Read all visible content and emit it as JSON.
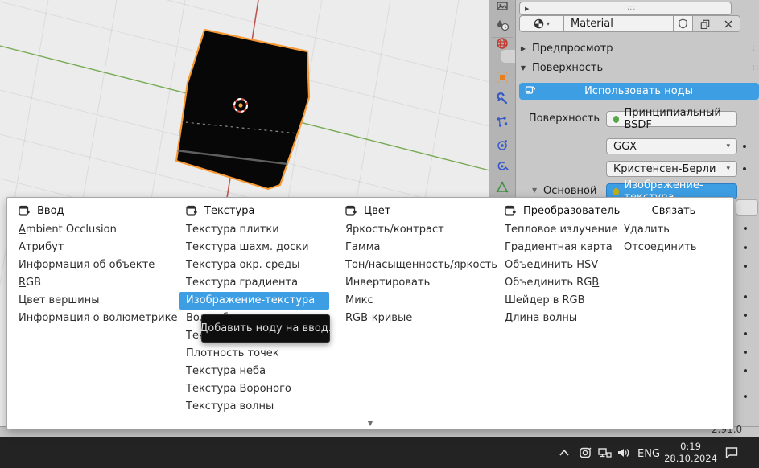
{
  "properties": {
    "accent": "#3d9ee4",
    "slot_list_grip": "∷∷",
    "material": {
      "name": "Material"
    },
    "panels": {
      "preview": "Предпросмотр",
      "surface": "Поверхность"
    },
    "use_nodes_label": "Использовать ноды",
    "surface_label": "Поверхность",
    "surface_value": "Принципиальный BSDF",
    "surface_dot_color": "#57a64a",
    "distribution": "GGX",
    "subsurface_method": "Кристенсен-Берли",
    "base_color_label": "Основной цв...",
    "base_color_value": "Изображение-текстура",
    "base_color_dot_color": "#c4ad13",
    "version": "2.91.0"
  },
  "menu": {
    "selected": {
      "column": 1,
      "item": 4
    },
    "selected_color": "#3d9ee4",
    "columns": [
      {
        "header": "Ввод",
        "items": [
          {
            "label": "Ambient Occlusion",
            "u": 0
          },
          {
            "label": "Атрибут"
          },
          {
            "label": "Информация об объекте"
          },
          {
            "label": "RGB",
            "u": 0
          },
          {
            "label": "Цвет вершины"
          },
          {
            "label": "Информация о волюметрике"
          }
        ]
      },
      {
        "header": "Текстура",
        "items": [
          {
            "label": "Текстура плитки"
          },
          {
            "label": "Текстура шахм. доски"
          },
          {
            "label": "Текстура окр. среды"
          },
          {
            "label": "Текстура градиента"
          },
          {
            "label": "Изображение-текстура"
          },
          {
            "label": "Волшебная текстура"
          },
          {
            "label": "Текстура Масгрейва"
          },
          {
            "label": "Плотность точек"
          },
          {
            "label": "Текстура неба"
          },
          {
            "label": "Текстура Вороного"
          },
          {
            "label": "Текстура волны"
          }
        ]
      },
      {
        "header": "Цвет",
        "items": [
          {
            "label": "Яркость/контраст"
          },
          {
            "label": "Гамма"
          },
          {
            "label": "Тон/насыщенность/яркость"
          },
          {
            "label": "Инвертировать"
          },
          {
            "label": "Микс"
          },
          {
            "label": "RGB-кривые",
            "u": 1
          }
        ]
      },
      {
        "header": "Преобразователь",
        "items": [
          {
            "label": "Тепловое излучение"
          },
          {
            "label": "Градиентная карта"
          },
          {
            "label": "Объединить HSV",
            "u": 11
          },
          {
            "label": "Объединить RGB",
            "u": 13
          },
          {
            "label": "Шейдер в RGB"
          },
          {
            "label": "Длина волны"
          }
        ]
      },
      {
        "header": "Связать",
        "items": [
          {
            "label": "Удалить"
          },
          {
            "label": "Отсоединить"
          }
        ]
      }
    ],
    "scroll_down_glyph": "▼"
  },
  "tooltip": {
    "text": "Добавить ноду на ввод."
  },
  "taskbar": {
    "lang": "ENG",
    "time": "0:19",
    "date": "28.10.2024"
  }
}
